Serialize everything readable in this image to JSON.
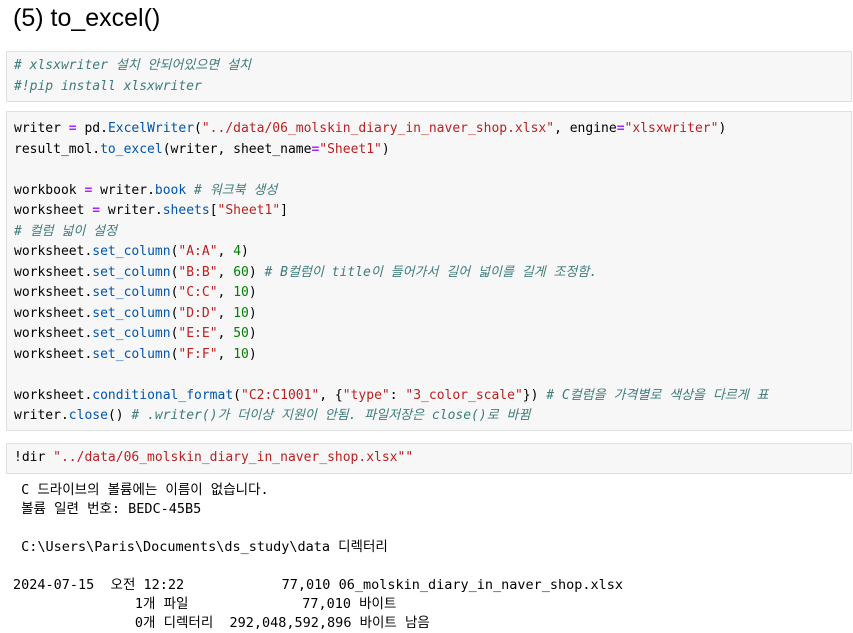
{
  "heading": "(5) to_excel()",
  "cell1": {
    "line1": "# xlsxwriter 설치 안되어있으면 설치",
    "line2": "#!pip install xlsxwriter"
  },
  "cell2": {
    "excel_path": "\"../data/06_molskin_diary_in_naver_shop.xlsx\"",
    "engine": "\"xlsxwriter\"",
    "sheet_name": "\"Sheet1\"",
    "comment_book": "# 워크북 생성",
    "comment_width": "# 컬럼 넓이 설정",
    "columns": [
      {
        "range": "\"A:A\"",
        "width": "4",
        "comment": ""
      },
      {
        "range": "\"B:B\"",
        "width": "60",
        "comment": "# B컬럼이 title이 들어가서 길어 넓이를 길게 조정함."
      },
      {
        "range": "\"C:C\"",
        "width": "10",
        "comment": ""
      },
      {
        "range": "\"D:D\"",
        "width": "10",
        "comment": ""
      },
      {
        "range": "\"E:E\"",
        "width": "50",
        "comment": ""
      },
      {
        "range": "\"F:F\"",
        "width": "10",
        "comment": ""
      }
    ],
    "cf_range": "\"C2:C1001\"",
    "cf_key": "\"type\"",
    "cf_value": "\"3_color_scale\"",
    "comment_cf": "# C컬럼을 가격별로 색상을 다르게 표",
    "comment_close": "# .writer()가 더이상 지원이 안됨. 파일저장은 close()로 바뀜"
  },
  "cell3": {
    "command": "!dir ",
    "arg": "\"../data/06_molskin_diary_in_naver_shop.xlsx\"\""
  },
  "output": {
    "lines": [
      " C 드라이브의 볼륨에는 이름이 없습니다.",
      " 볼륨 일련 번호: BEDC-45B5",
      "",
      " C:\\Users\\Paris\\Documents\\ds_study\\data 디렉터리",
      "",
      "2024-07-15  오전 12:22            77,010 06_molskin_diary_in_naver_shop.xlsx",
      "               1개 파일              77,010 바이트",
      "               0개 디렉터리  292,048,592,896 바이트 남음"
    ]
  }
}
